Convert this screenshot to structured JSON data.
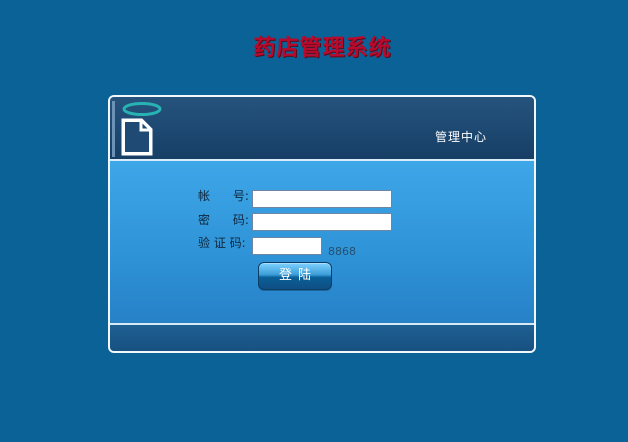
{
  "header": {
    "title": "药店管理系统"
  },
  "panel": {
    "header_text": "管理中心",
    "form": {
      "account_label": "帐      号:",
      "password_label": "密      码:",
      "captcha_label": "验 证 码:",
      "account_value": "",
      "password_value": "",
      "captcha_value": "",
      "captcha_code": "8868",
      "login_label": "登陆"
    }
  },
  "colors": {
    "background": "#0b6297",
    "title": "#b80a2c",
    "panel_header": "#1e4a73",
    "panel_body": "#2f94d8",
    "panel_footer": "#17507f"
  },
  "icons": {
    "logo": "document-halo-icon"
  }
}
